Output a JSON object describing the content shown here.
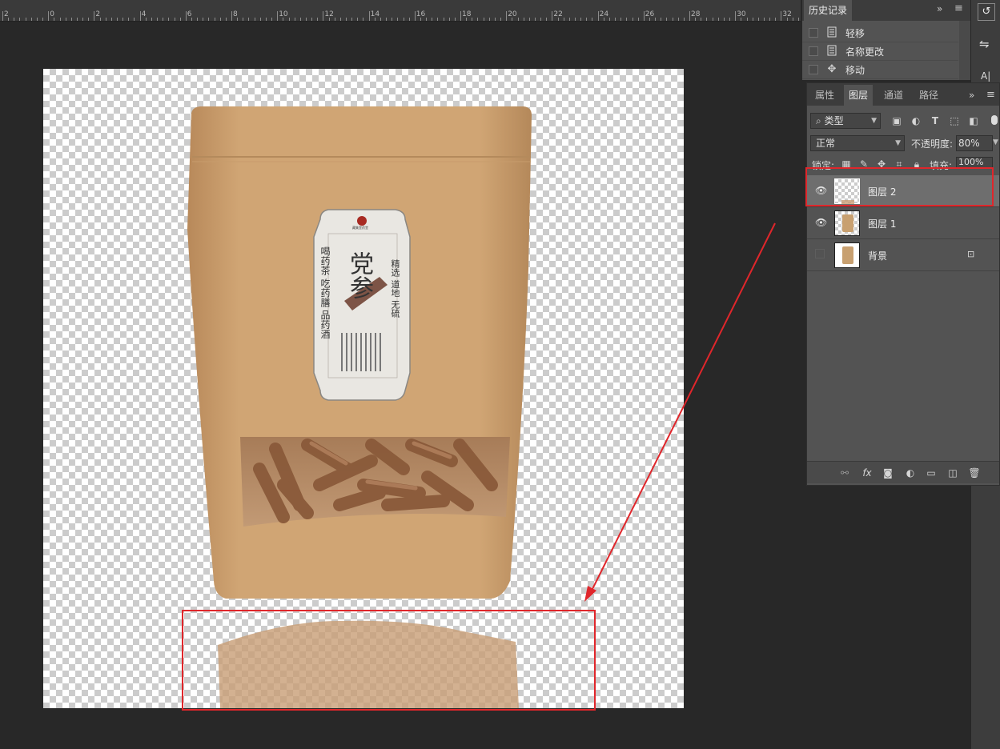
{
  "ruler": {
    "ticks": [
      "2",
      "0",
      "2",
      "4",
      "6",
      "8",
      "10",
      "12",
      "14",
      "16",
      "18",
      "20",
      "22",
      "24",
      "26",
      "28",
      "30",
      "32"
    ]
  },
  "history": {
    "tab": "历史记录",
    "items": [
      {
        "label": "轻移",
        "icon": "document-icon"
      },
      {
        "label": "名称更改",
        "icon": "document-icon"
      },
      {
        "label": "移动",
        "icon": "move-icon"
      }
    ]
  },
  "layers_panel": {
    "tabs": [
      "属性",
      "图层",
      "通道",
      "路径"
    ],
    "active_tab": "图层",
    "filter_label": "类型",
    "blend_mode": "正常",
    "opacity_label": "不透明度:",
    "opacity_value": "80%",
    "lock_label": "锁定:",
    "fill_label": "填充:",
    "fill_value": "100%",
    "layers": [
      {
        "name": "图层 2",
        "visible": true,
        "selected": true
      },
      {
        "name": "图层 1",
        "visible": true,
        "selected": false
      },
      {
        "name": "背景",
        "visible": false,
        "selected": false,
        "locked": true
      }
    ],
    "bottom_icons": [
      "link-icon",
      "fx-icon",
      "mask-icon",
      "adjustment-icon",
      "folder-icon",
      "new-layer-icon",
      "trash-icon"
    ]
  },
  "product_label": {
    "title": "党参",
    "brand": "藏集堂药堂",
    "left_text": "喝药茶 吃药膳 品药酒",
    "right_text": "精选 道地 无硫"
  },
  "colors": {
    "accent_red": "#e0262b",
    "bag": "#c8a070",
    "panel": "#535353"
  }
}
